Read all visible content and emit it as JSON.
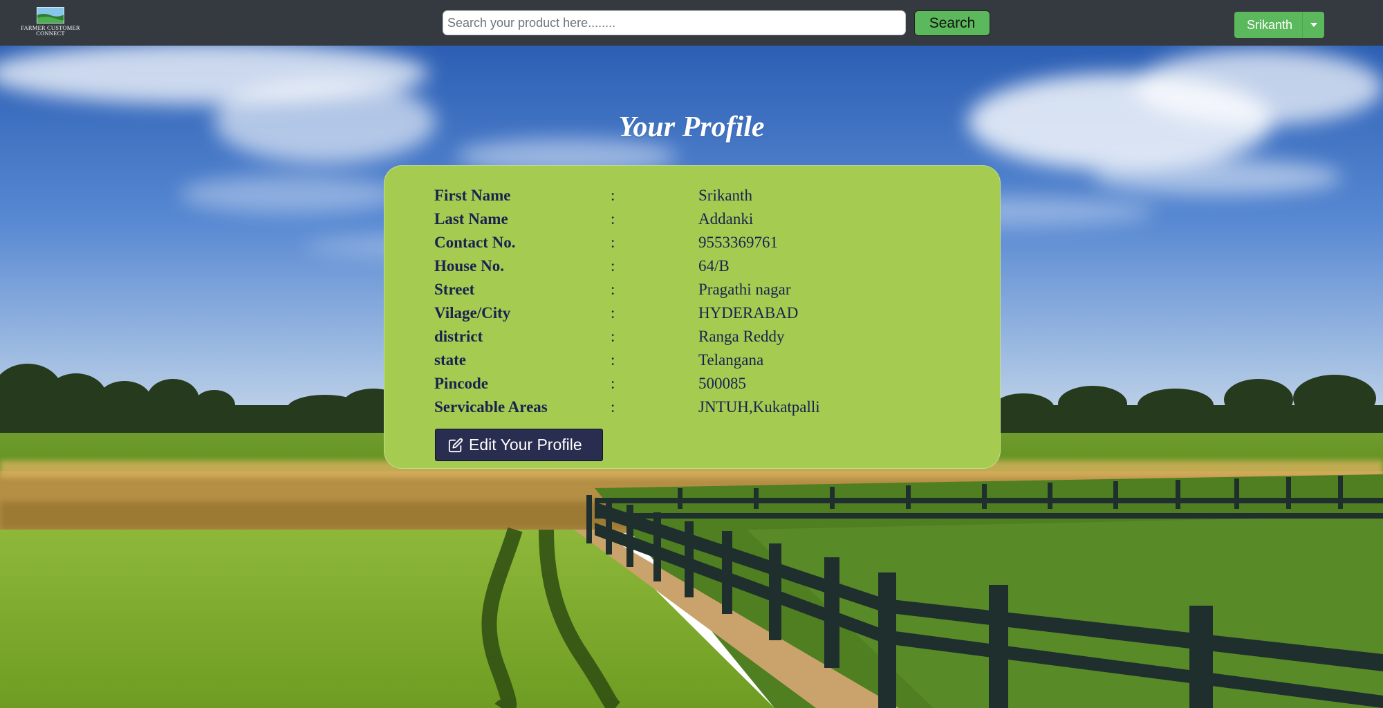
{
  "header": {
    "logo_text": "FARMER CUSTOMER CONNECT",
    "search_placeholder": "Search your product here........",
    "search_value": "",
    "search_button": "Search",
    "user_name": "Srikanth",
    "user_menu_icon": "caret-down-icon"
  },
  "page": {
    "title": "Your Profile",
    "separator": ":",
    "fields": [
      {
        "label": "First Name",
        "value": "Srikanth"
      },
      {
        "label": "Last Name",
        "value": "Addanki"
      },
      {
        "label": "Contact No.",
        "value": "9553369761"
      },
      {
        "label": "House No.",
        "value": "64/B"
      },
      {
        "label": "Street",
        "value": "Pragathi nagar"
      },
      {
        "label": "Vilage/City",
        "value": "HYDERABAD"
      },
      {
        "label": "district",
        "value": "Ranga Reddy"
      },
      {
        "label": "state",
        "value": "Telangana"
      },
      {
        "label": "Pincode",
        "value": "500085"
      },
      {
        "label": "Servicable Areas",
        "value": "JNTUH,Kukatpalli"
      }
    ],
    "edit_button": "Edit Your Profile",
    "edit_icon": "edit-icon"
  },
  "colors": {
    "navbar": "#343a40",
    "accent_green": "#5cb85c",
    "card": "#a5cb51",
    "text_navy": "#1b2250",
    "button_navy": "#292d4f"
  }
}
